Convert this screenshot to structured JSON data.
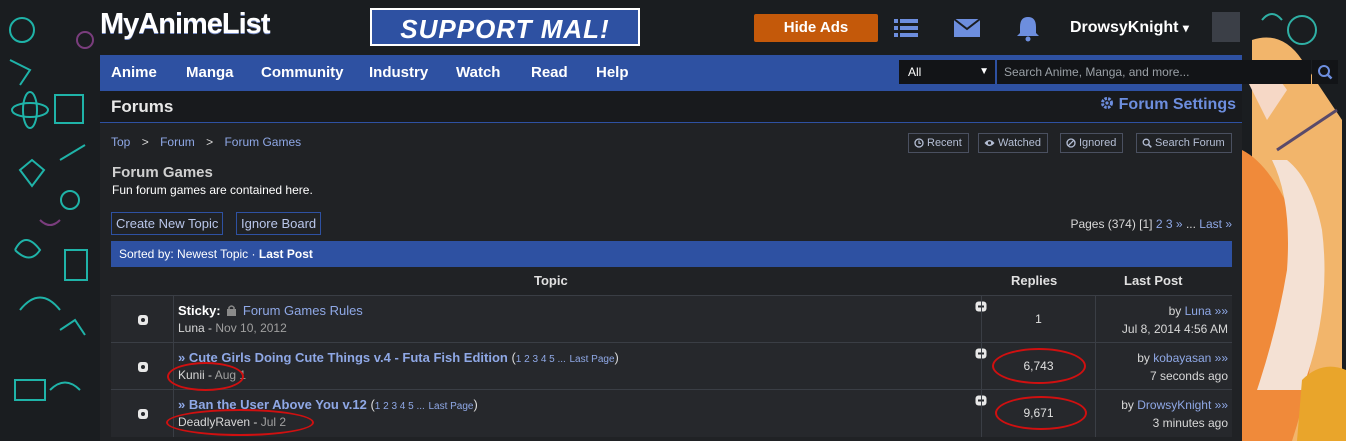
{
  "site": {
    "logo": "MyAnimeList",
    "support_banner": "SUPPORT MAL!",
    "hide_ads": "Hide Ads",
    "username": "DrowsyKnight",
    "username_caret": "▾"
  },
  "nav": {
    "items": [
      "Anime",
      "Manga",
      "Community",
      "Industry",
      "Watch",
      "Read",
      "Help"
    ],
    "search_scope": "All",
    "search_placeholder": "Search Anime, Manga, and more..."
  },
  "forum": {
    "title": "Forums",
    "settings": "Forum Settings",
    "breadcrumb": [
      "Top",
      "Forum",
      "Forum Games"
    ],
    "breadcrumb_sep": ">",
    "tools": [
      "Recent",
      "Watched",
      "Ignored",
      "Search Forum"
    ],
    "board_title": "Forum Games",
    "board_desc": "Fun forum games are contained here.",
    "create_topic": "Create New Topic",
    "ignore_board": "Ignore Board",
    "pages": {
      "prefix": "Pages (374)",
      "current": "[1]",
      "p2": "2",
      "p3": "3",
      "next": "»",
      "ellipsis": "...",
      "last": "Last »"
    },
    "sort": {
      "prefix": "Sorted by: Newest Topic ·",
      "active": "Last Post"
    },
    "columns": {
      "topic": "Topic",
      "replies": "Replies",
      "last_post": "Last Post"
    },
    "rows": [
      {
        "sticky": "Sticky:",
        "title": "Forum Games Rules",
        "author": "Luna",
        "date": "Nov 10, 2012",
        "replies": "1",
        "last_by": "Luna",
        "last_time": "Jul 8, 2014 4:56 AM"
      },
      {
        "title": "» Cute Girls Doing Cute Things v.4 - Futa Fish Edition",
        "pages": "1 2 3 4 5 ...",
        "last_page": "Last Page",
        "author": "Kunii",
        "date": "Aug 1",
        "replies": "6,743",
        "last_by": "kobayasan",
        "last_time": "7 seconds ago"
      },
      {
        "title": "» Ban the User Above You v.12",
        "pages": "1 2 3 4 5 ...",
        "last_page": "Last Page",
        "author": "DeadlyRaven",
        "date": "Jul 2",
        "replies": "9,671",
        "last_by": "DrowsyKnight",
        "last_time": "3 minutes ago"
      }
    ]
  },
  "colors": {
    "mal_blue": "#2e51a2",
    "hide_ads_orange": "#c4590a",
    "link_blue": "#8fa8e6",
    "annotation_red": "#d01010"
  },
  "icons": [
    "list-icon",
    "mail-icon",
    "bell-icon",
    "gear-icon",
    "clock-icon",
    "eye-icon",
    "ban-icon",
    "search-icon",
    "topic-icon",
    "lock-icon",
    "speech-icon"
  ]
}
